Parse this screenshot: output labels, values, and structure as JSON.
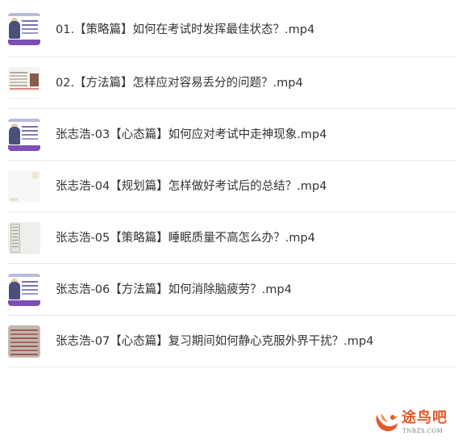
{
  "files": [
    {
      "name": "01.【策略篇】如何在考试时发挥最佳状态？.mp4",
      "thumbnail": "purple"
    },
    {
      "name": "02.【方法篇】怎样应对容易丢分的问题？.mp4",
      "thumbnail": "white"
    },
    {
      "name": "张志浩-03【心态篇】如何应对考试中走神现象.mp4",
      "thumbnail": "purple"
    },
    {
      "name": "张志浩-04【规划篇】怎样做好考试后的总结？.mp4",
      "thumbnail": "blank"
    },
    {
      "name": "张志浩-05【策略篇】睡眠质量不高怎么办？.mp4",
      "thumbnail": "paper"
    },
    {
      "name": "张志浩-06【方法篇】如何消除脑疲劳？.mp4",
      "thumbnail": "purple"
    },
    {
      "name": "张志浩-07【心态篇】复习期间如何静心克服外界干扰？.mp4",
      "thumbnail": "red"
    }
  ],
  "watermark": {
    "title": "途鸟吧",
    "domain": "TNBZS.COM",
    "icon": "bird-logo-icon",
    "color": "#e25a2c"
  }
}
